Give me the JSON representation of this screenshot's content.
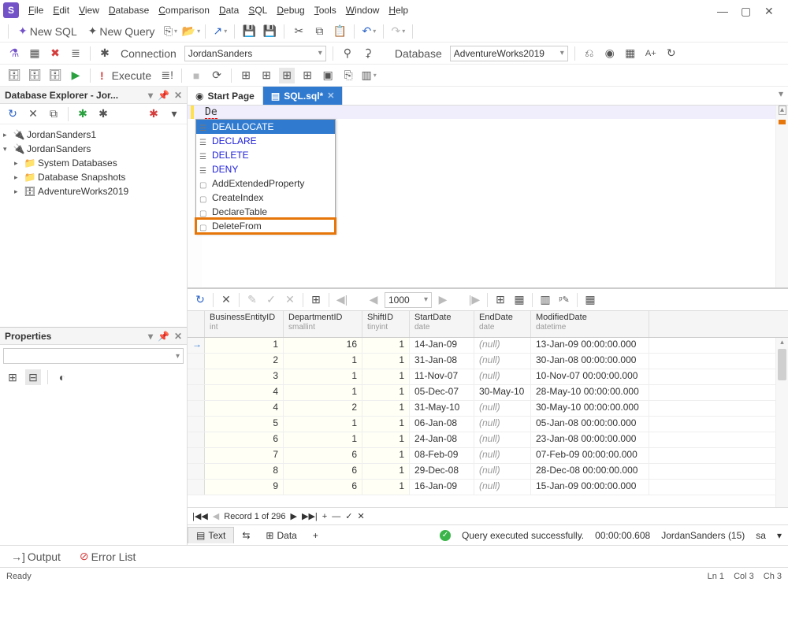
{
  "menu": [
    "File",
    "Edit",
    "View",
    "Database",
    "Comparison",
    "Data",
    "SQL",
    "Debug",
    "Tools",
    "Window",
    "Help"
  ],
  "tb1": {
    "newSql": "New SQL",
    "newQuery": "New Query"
  },
  "conn": {
    "label": "Connection",
    "value": "JordanSanders",
    "dbLabel": "Database",
    "dbValue": "AdventureWorks2019"
  },
  "exec": {
    "label": "Execute"
  },
  "explorer": {
    "title": "Database Explorer - Jor...",
    "items": [
      {
        "label": "JordanSanders1"
      },
      {
        "label": "JordanSanders"
      },
      {
        "label": "System Databases"
      },
      {
        "label": "Database Snapshots"
      },
      {
        "label": "AdventureWorks2019"
      }
    ]
  },
  "props": {
    "title": "Properties"
  },
  "tabs": {
    "start": "Start Page",
    "sql": "SQL.sql*"
  },
  "editorText": "De",
  "autocomplete": [
    {
      "t": "DEALLOCATE",
      "k": "kw",
      "sel": true
    },
    {
      "t": "DECLARE",
      "k": "kw"
    },
    {
      "t": "DELETE",
      "k": "kw"
    },
    {
      "t": "DENY",
      "k": "kw"
    },
    {
      "t": "AddExtendedProperty",
      "k": "sn"
    },
    {
      "t": "CreateIndex",
      "k": "sn"
    },
    {
      "t": "DeclareTable",
      "k": "sn"
    },
    {
      "t": "DeleteFrom",
      "k": "sn",
      "hl": true
    }
  ],
  "pager": "1000",
  "cols": [
    {
      "n": "BusinessEntityID",
      "t": "int"
    },
    {
      "n": "DepartmentID",
      "t": "smallint"
    },
    {
      "n": "ShiftID",
      "t": "tinyint"
    },
    {
      "n": "StartDate",
      "t": "date"
    },
    {
      "n": "EndDate",
      "t": "date"
    },
    {
      "n": "ModifiedDate",
      "t": "datetime"
    }
  ],
  "rows": [
    [
      "1",
      "16",
      "1",
      "14-Jan-09",
      "(null)",
      "13-Jan-09 00:00:00.000"
    ],
    [
      "2",
      "1",
      "1",
      "31-Jan-08",
      "(null)",
      "30-Jan-08 00:00:00.000"
    ],
    [
      "3",
      "1",
      "1",
      "11-Nov-07",
      "(null)",
      "10-Nov-07 00:00:00.000"
    ],
    [
      "4",
      "1",
      "1",
      "05-Dec-07",
      "30-May-10",
      "28-May-10 00:00:00.000"
    ],
    [
      "4",
      "2",
      "1",
      "31-May-10",
      "(null)",
      "30-May-10 00:00:00.000"
    ],
    [
      "5",
      "1",
      "1",
      "06-Jan-08",
      "(null)",
      "05-Jan-08 00:00:00.000"
    ],
    [
      "6",
      "1",
      "1",
      "24-Jan-08",
      "(null)",
      "23-Jan-08 00:00:00.000"
    ],
    [
      "7",
      "6",
      "1",
      "08-Feb-09",
      "(null)",
      "07-Feb-09 00:00:00.000"
    ],
    [
      "8",
      "6",
      "1",
      "29-Dec-08",
      "(null)",
      "28-Dec-08 00:00:00.000"
    ],
    [
      "9",
      "6",
      "1",
      "16-Jan-09",
      "(null)",
      "15-Jan-09 00:00:00.000"
    ]
  ],
  "nav": {
    "record": "Record 1 of 296"
  },
  "restabs": {
    "text": "Text",
    "data": "Data"
  },
  "status": {
    "msg": "Query executed successfully.",
    "time": "00:00:00.608",
    "conn": "JordanSanders (15)",
    "user": "sa"
  },
  "bottom": {
    "output": "Output",
    "errors": "Error List"
  },
  "sb": {
    "ready": "Ready",
    "ln": "Ln 1",
    "col": "Col 3",
    "ch": "Ch 3"
  }
}
